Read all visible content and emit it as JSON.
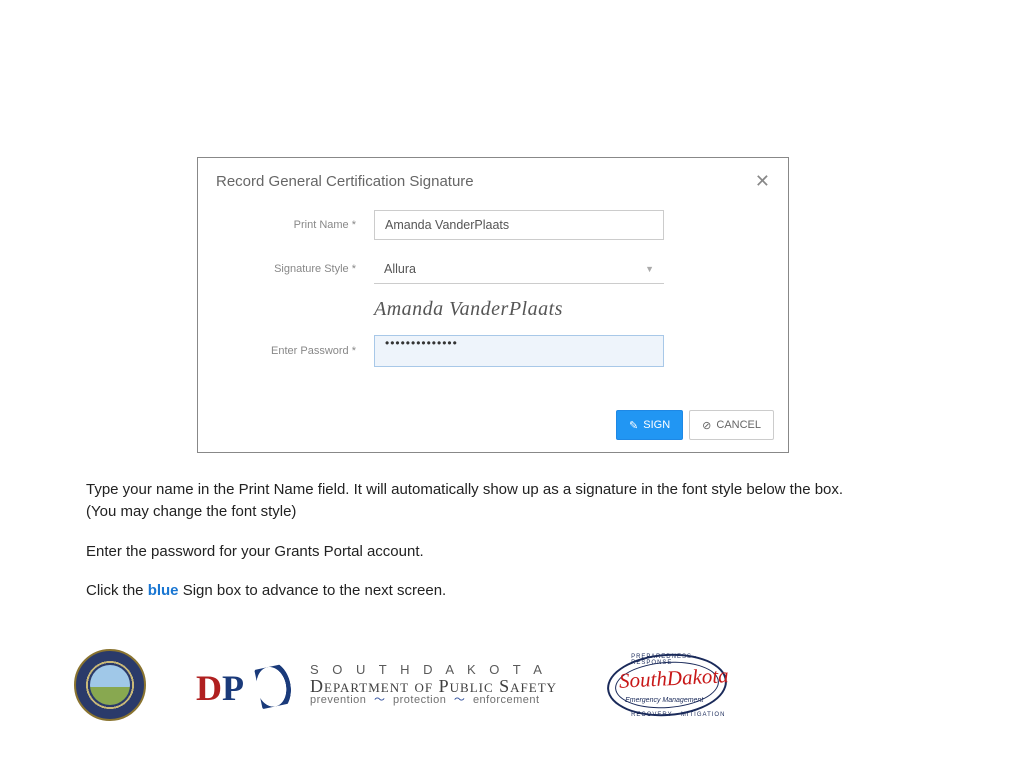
{
  "dialog": {
    "title": "Record General Certification Signature",
    "print_name_label": "Print Name *",
    "print_name_value": "Amanda VanderPlaats",
    "style_label": "Signature Style *",
    "style_value": "Allura",
    "signature_preview": "Amanda VanderPlaats",
    "password_label": "Enter Password *",
    "password_value": "••••••••••••••",
    "sign_label": "SIGN",
    "cancel_label": "CANCEL"
  },
  "instructions": {
    "p1a": "Type your name in the Print Name field. It will automatically show up as a signature in the font style below the box.",
    "p1b": "(You may change the font style)",
    "p2": "Enter the password for your Grants Portal account.",
    "p3a": "Click the ",
    "p3_blue": "blue",
    "p3b": " Sign box to advance to the next screen."
  },
  "logos": {
    "dps_sd": "S O U T H   D A K O T A",
    "dps_main": "Department of Public Safety",
    "dps_sub_a": "prevention",
    "dps_sub_b": "protection",
    "dps_sub_c": "enforcement",
    "oem_script": "SouthDakota",
    "oem_sub": "Emergency Management",
    "oem_top": "PREPAREDNESS · RESPONSE",
    "oem_bot": "RECOVERY · MITIGATION"
  }
}
